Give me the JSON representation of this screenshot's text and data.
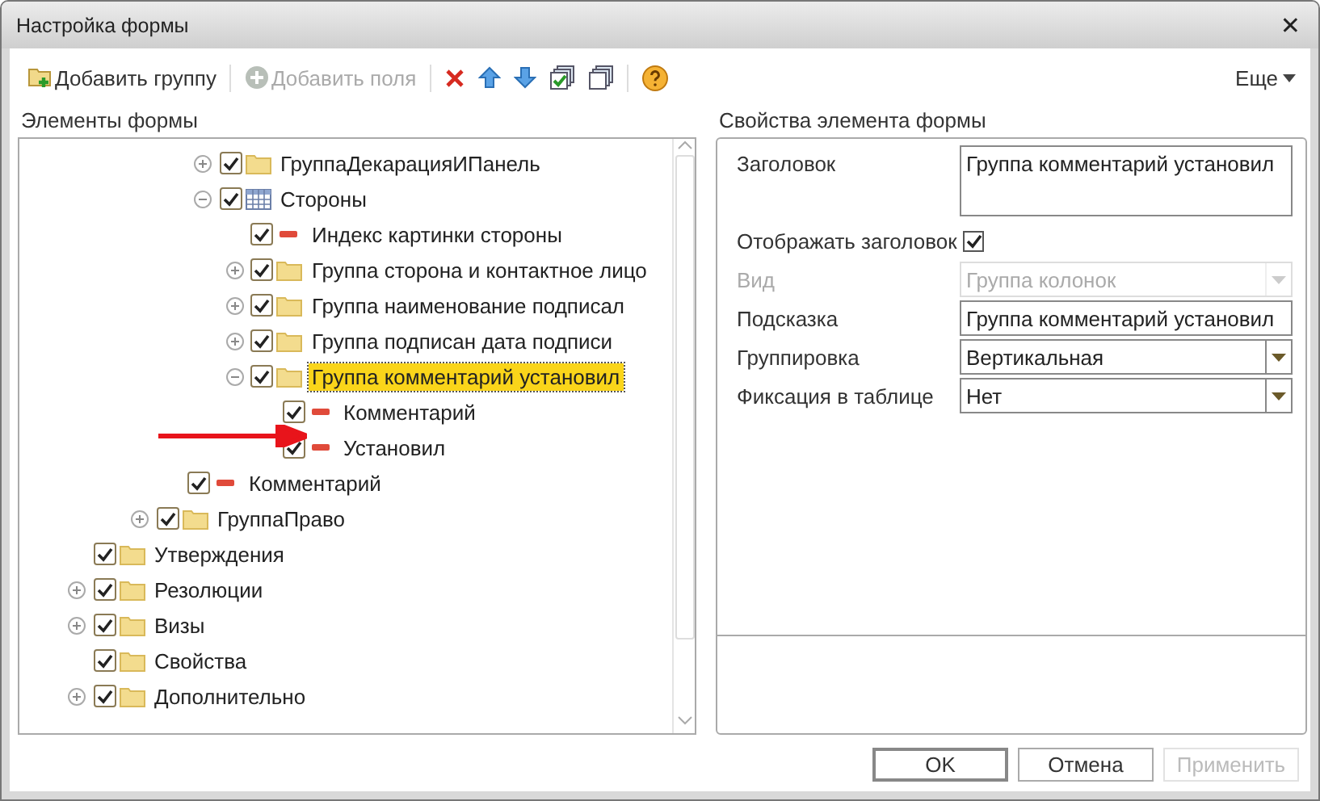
{
  "window": {
    "title": "Настройка формы",
    "close": "✕"
  },
  "toolbar": {
    "items": [
      {
        "kind": "add-group",
        "label": "Добавить группу",
        "disabled": false
      },
      {
        "kind": "separator"
      },
      {
        "kind": "add-field",
        "label": "Добавить поля",
        "disabled": true
      },
      {
        "kind": "separator"
      },
      {
        "kind": "delete"
      },
      {
        "kind": "up"
      },
      {
        "kind": "down"
      },
      {
        "kind": "check-all"
      },
      {
        "kind": "uncheck-all"
      },
      {
        "kind": "separator"
      },
      {
        "kind": "help"
      }
    ],
    "more": "Еще"
  },
  "tree_title": "Элементы формы",
  "tree": [
    {
      "children": [
        {
          "children": [
            {
              "children": [
                {
                  "children": [
                    {
                      "label": "ГруппаДекарацияИПанель",
                      "kind": "folder",
                      "checked": true,
                      "expanded": false,
                      "selected": false
                    },
                    {
                      "label": "Стороны",
                      "kind": "table",
                      "checked": true,
                      "expanded": true,
                      "selected": false,
                      "children": [
                        {
                          "label": "Индекс картинки стороны",
                          "kind": "field",
                          "checked": true,
                          "selected": false
                        },
                        {
                          "label": "Группа сторона и контактное лицо",
                          "kind": "folder",
                          "checked": true,
                          "expanded": false,
                          "selected": false
                        },
                        {
                          "label": "Группа наименование подписал",
                          "kind": "folder",
                          "checked": true,
                          "expanded": false,
                          "selected": false
                        },
                        {
                          "label": "Группа подписан дата подписи",
                          "kind": "folder",
                          "checked": true,
                          "expanded": false,
                          "selected": false
                        },
                        {
                          "label": "Группа комментарий установил",
                          "kind": "folder",
                          "checked": true,
                          "expanded": true,
                          "selected": true,
                          "children": [
                            {
                              "label": "Комментарий",
                              "kind": "field",
                              "checked": true,
                              "selected": false
                            },
                            {
                              "label": "Установил",
                              "kind": "field",
                              "checked": true,
                              "selected": false
                            }
                          ]
                        }
                      ]
                    }
                  ]
                },
                {
                  "label": "Комментарий",
                  "kind": "field",
                  "checked": true,
                  "selected": false
                }
              ]
            },
            {
              "label": "ГруппаПраво",
              "kind": "folder",
              "checked": true,
              "expanded": false,
              "selected": false
            }
          ]
        }
      ]
    },
    {
      "label": "Утверждения",
      "kind": "folder",
      "checked": true,
      "selected": false
    },
    {
      "label": "Резолюции",
      "kind": "folder",
      "checked": true,
      "expanded": false,
      "selected": false
    },
    {
      "label": "Визы",
      "kind": "folder",
      "checked": true,
      "expanded": false,
      "selected": false
    },
    {
      "label": "Свойства",
      "kind": "folder",
      "checked": true,
      "selected": false
    },
    {
      "label": "Дополнительно",
      "kind": "folder",
      "checked": true,
      "expanded": false,
      "selected": false
    }
  ],
  "properties_title": "Свойства элемента формы",
  "properties": [
    {
      "kind": "textarea",
      "label": "Заголовок",
      "value": "Группа комментарий установил",
      "disabled": false
    },
    {
      "kind": "checkbox",
      "label": "Отображать заголовок",
      "checked": true,
      "disabled": false
    },
    {
      "kind": "select",
      "label": "Вид",
      "value": "Группа колонок",
      "disabled": true
    },
    {
      "kind": "text",
      "label": "Подсказка",
      "value": "Группа комментарий установил",
      "disabled": false
    },
    {
      "kind": "select",
      "label": "Группировка",
      "value": "Вертикальная",
      "disabled": false
    },
    {
      "kind": "select",
      "label": "Фиксация в таблице",
      "value": "Нет",
      "disabled": false
    }
  ],
  "buttons": [
    {
      "label": "OK",
      "default": true,
      "disabled": false
    },
    {
      "label": "Отмена",
      "default": false,
      "disabled": false
    },
    {
      "label": "Применить",
      "default": false,
      "disabled": true
    }
  ]
}
